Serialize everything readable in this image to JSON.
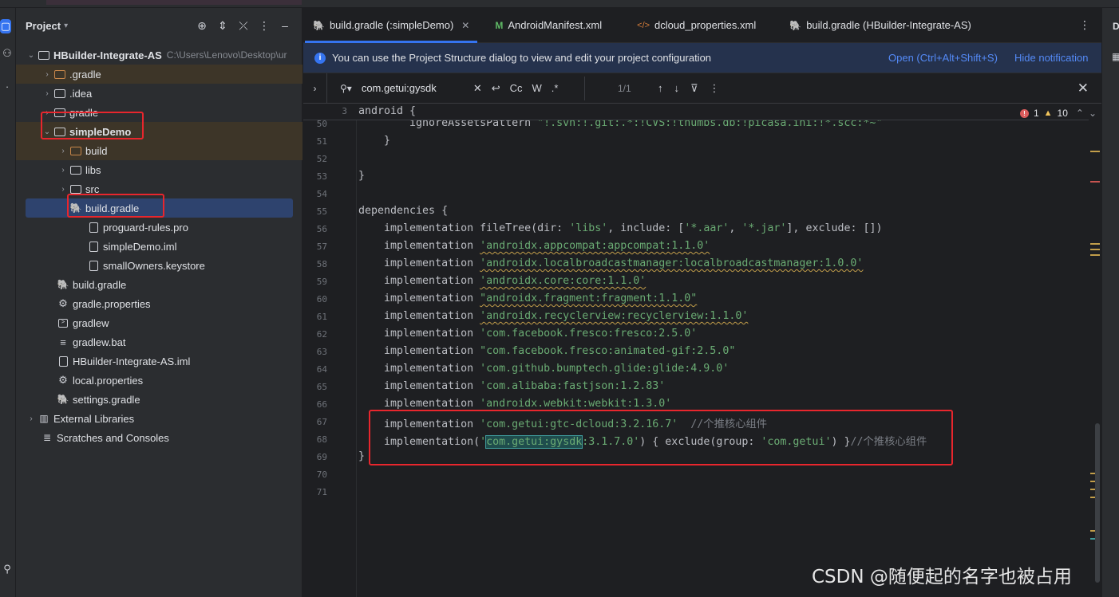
{
  "project_panel": {
    "title": "Project",
    "tree": [
      {
        "label": "HBuilder-Integrate-AS",
        "path": "C:\\Users\\Lenovo\\Desktop\\ur",
        "bold": true
      },
      {
        "label": ".gradle"
      },
      {
        "label": ".idea"
      },
      {
        "label": "gradle"
      },
      {
        "label": "simpleDemo",
        "bold": true
      },
      {
        "label": "build"
      },
      {
        "label": "libs"
      },
      {
        "label": "src"
      },
      {
        "label": "build.gradle"
      },
      {
        "label": "proguard-rules.pro"
      },
      {
        "label": "simpleDemo.iml"
      },
      {
        "label": "smallOwners.keystore"
      },
      {
        "label": "build.gradle"
      },
      {
        "label": "gradle.properties"
      },
      {
        "label": "gradlew"
      },
      {
        "label": "gradlew.bat"
      },
      {
        "label": "HBuilder-Integrate-AS.iml"
      },
      {
        "label": "local.properties"
      },
      {
        "label": "settings.gradle"
      },
      {
        "label": "External Libraries"
      },
      {
        "label": "Scratches and Consoles"
      }
    ]
  },
  "tabs": [
    {
      "label": "build.gradle (:simpleDemo)"
    },
    {
      "label": "AndroidManifest.xml"
    },
    {
      "label": "dcloud_properties.xml"
    },
    {
      "label": "build.gradle (HBuilder-Integrate-AS)"
    }
  ],
  "notification": {
    "message": "You can use the Project Structure dialog to view and edit your project configuration",
    "open_link": "Open (Ctrl+Alt+Shift+S)",
    "hide_link": "Hide notification"
  },
  "search": {
    "query": "com.getui:gysdk",
    "case_label": "Cc",
    "word_label": "W",
    "regex_label": ".*",
    "count": "1/1"
  },
  "problems": {
    "errors": "1",
    "warnings": "10"
  },
  "right_panel": {
    "label": "D"
  },
  "colors": {
    "accent": "#3574f0",
    "string": "#6aab73",
    "annotation_box": "#e8262d"
  },
  "code": {
    "sticky_line_number": "3",
    "sticky_text": "android {",
    "lines": [
      {
        "n": "50",
        "text": "        ignoreAssetsPattern \"!.svn:!.git:.*:!CVS:!thumbs.db:!picasa.ini:!*.scc:*~\""
      },
      {
        "n": "51",
        "text": "    }"
      },
      {
        "n": "52",
        "text": ""
      },
      {
        "n": "53",
        "text": "}"
      },
      {
        "n": "54",
        "text": ""
      },
      {
        "n": "55",
        "text": "dependencies {"
      },
      {
        "n": "56",
        "text": "    implementation fileTree(dir: 'libs', include: ['*.aar', '*.jar'], exclude: [])"
      },
      {
        "n": "57",
        "text": "    implementation 'androidx.appcompat:appcompat:1.1.0'"
      },
      {
        "n": "58",
        "text": "    implementation 'androidx.localbroadcastmanager:localbroadcastmanager:1.0.0'"
      },
      {
        "n": "59",
        "text": "    implementation 'androidx.core:core:1.1.0'"
      },
      {
        "n": "60",
        "text": "    implementation \"androidx.fragment:fragment:1.1.0\""
      },
      {
        "n": "61",
        "text": "    implementation 'androidx.recyclerview:recyclerview:1.1.0'"
      },
      {
        "n": "62",
        "text": "    implementation 'com.facebook.fresco:fresco:2.5.0'"
      },
      {
        "n": "63",
        "text": "    implementation \"com.facebook.fresco:animated-gif:2.5.0\""
      },
      {
        "n": "64",
        "text": "    implementation 'com.github.bumptech.glide:glide:4.9.0'"
      },
      {
        "n": "65",
        "text": "    implementation 'com.alibaba:fastjson:1.2.83'"
      },
      {
        "n": "66",
        "text": "    implementation 'androidx.webkit:webkit:1.3.0'"
      },
      {
        "n": "67",
        "text": "    implementation 'com.getui:gtc-dcloud:3.2.16.7'  //个推核心组件"
      },
      {
        "n": "68",
        "text": "    implementation('com.getui:gysdk:3.1.7.0') { exclude(group: 'com.getui') }//个推核心组件"
      },
      {
        "n": "69",
        "text": "}"
      },
      {
        "n": "70",
        "text": ""
      },
      {
        "n": "71",
        "text": ""
      }
    ]
  },
  "watermark": "CSDN @随便起的名字也被占用"
}
